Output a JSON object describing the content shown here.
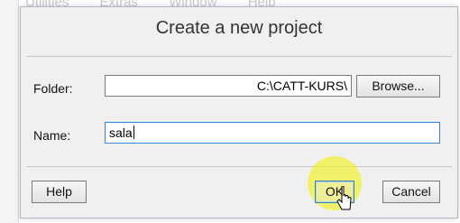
{
  "background_menu": [
    "Utilities",
    "Extras",
    "Window",
    "Help"
  ],
  "dialog": {
    "title": "Create a new project",
    "folder_label": "Folder:",
    "folder_value": "C:\\CATT-KURS\\",
    "browse_label": "Browse...",
    "name_label": "Name:",
    "name_value": "sala",
    "help_label": "Help",
    "ok_label": "OK",
    "cancel_label": "Cancel"
  },
  "colors": {
    "dialog_bg": "#f0f0f0",
    "focus_border": "#2e87d6",
    "click_highlight": "#f0f03c"
  },
  "icons": [
    "mouse-pointer-icon"
  ]
}
